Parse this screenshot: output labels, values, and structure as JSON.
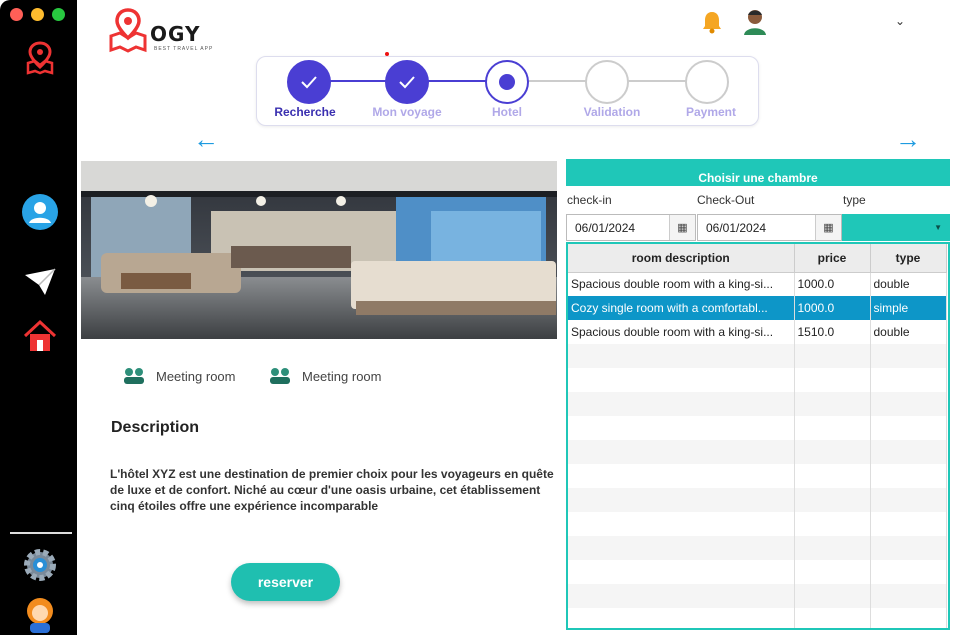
{
  "app": {
    "logo_text": "OGY",
    "logo_subtitle": "BEST TRAVEL APP",
    "colors": {
      "accent": "#1fc7b8",
      "primary": "#4a3ed3",
      "selected_row": "#0d96c8",
      "sidebar": "#000000"
    }
  },
  "sidebar": {
    "icons": [
      "map-logo-icon",
      "user-icon",
      "send-icon",
      "home-icon",
      "settings-icon",
      "support-icon"
    ]
  },
  "header": {
    "icons": [
      "bell-icon",
      "profile-icon",
      "chevron-down-icon"
    ]
  },
  "stepper": {
    "steps": [
      {
        "label": "Recherche",
        "state": "done"
      },
      {
        "label": "Mon voyage",
        "state": "done"
      },
      {
        "label": "Hotel",
        "state": "current"
      },
      {
        "label": "Validation",
        "state": "todo"
      },
      {
        "label": "Payment",
        "state": "todo"
      }
    ]
  },
  "hotel": {
    "amenities": [
      "Meeting room",
      "Meeting room"
    ],
    "description_title": "Description",
    "description": "L'hôtel XYZ est une destination de premier choix pour les voyageurs en quête de luxe et de confort. Niché au cœur d'une oasis urbaine, cet établissement cinq étoiles offre une expérience incomparable",
    "reserve_label": "reserver"
  },
  "rooms": {
    "header": "Choisir une chambre",
    "checkin_label": "check-in",
    "checkout_label": "Check-Out",
    "type_label": "type",
    "checkin_value": "06/01/2024",
    "checkout_value": "06/01/2024",
    "type_value": "",
    "columns": [
      "room description",
      "price",
      "type"
    ],
    "rows": [
      {
        "description": "Spacious double room with a king-si...",
        "price": "1000.0",
        "type": "double"
      },
      {
        "description": "Cozy single room with a comfortabl...",
        "price": "1000.0",
        "type": "simple"
      },
      {
        "description": "Spacious double room with a king-si...",
        "price": "1510.0",
        "type": "double"
      }
    ],
    "selected_index": 1
  }
}
